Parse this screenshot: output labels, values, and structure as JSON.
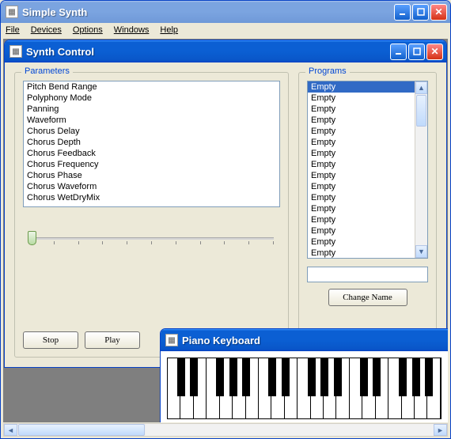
{
  "main_window": {
    "title": "Simple Synth",
    "menu": {
      "file": "File",
      "devices": "Devices",
      "options": "Options",
      "windows": "Windows",
      "help": "Help"
    }
  },
  "synth_window": {
    "title": "Synth Control",
    "parameters_label": "Parameters",
    "programs_label": "Programs",
    "parameters": [
      "Pitch Bend Range",
      "Polyphony Mode",
      "Panning",
      "Waveform",
      "Chorus Delay",
      "Chorus Depth",
      "Chorus Feedback",
      "Chorus Frequency",
      "Chorus Phase",
      "Chorus Waveform",
      "Chorus WetDryMix"
    ],
    "programs": [
      "Empty",
      "Empty",
      "Empty",
      "Empty",
      "Empty",
      "Empty",
      "Empty",
      "Empty",
      "Empty",
      "Empty",
      "Empty",
      "Empty",
      "Empty",
      "Empty",
      "Empty",
      "Empty"
    ],
    "program_selected_index": 0,
    "name_input_value": "",
    "buttons": {
      "stop": "Stop",
      "play": "Play",
      "change_name": "Change Name"
    },
    "slider": {
      "min": 0,
      "max": 10,
      "value": 0
    }
  },
  "piano_window": {
    "title": "Piano Keyboard",
    "white_keys": 21,
    "octaves": 3
  }
}
